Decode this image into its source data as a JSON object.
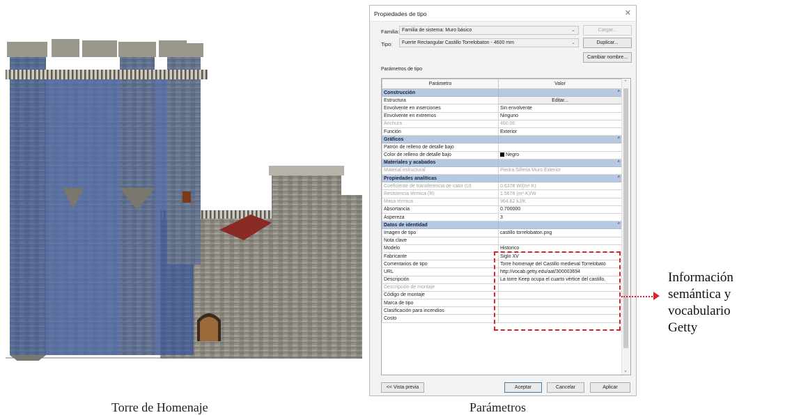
{
  "captions": {
    "left": "Torre de Homenaje",
    "right": "Parámetros"
  },
  "annotation": {
    "lines": [
      "Información",
      "semántica y",
      "vocabulario",
      "Getty"
    ],
    "color": "#e0202a"
  },
  "dialog": {
    "title": "Propiedades de tipo",
    "family_label": "Familia:",
    "family_value": "Familia de sistema: Muro básico",
    "type_label": "Tipo:",
    "type_value": "Fuerte Rectangular Castillo Torrelobaton - 4600 mm",
    "load_button": "Cargar...",
    "duplicate_button": "Duplicar...",
    "rename_button": "Cambiar nombre...",
    "params_label": "Parámetros de tipo",
    "col_param": "Parámetro",
    "col_value": "Valor",
    "preview_button": "<< Vista previa",
    "ok_button": "Aceptar",
    "cancel_button": "Cancelar",
    "apply_button": "Aplicar",
    "rows": [
      {
        "kind": "group",
        "param": "Construcción"
      },
      {
        "kind": "button",
        "param": "Estructura",
        "value": "Editar..."
      },
      {
        "kind": "row",
        "param": "Envolvente en inserciones",
        "value": "Sin envolvente"
      },
      {
        "kind": "row",
        "param": "Envolvente en extremos",
        "value": "Ninguno"
      },
      {
        "kind": "dim",
        "param": "Anchura",
        "value": "460.00"
      },
      {
        "kind": "row",
        "param": "Función",
        "value": "Exterior"
      },
      {
        "kind": "group",
        "param": "Gráficos"
      },
      {
        "kind": "row",
        "param": "Patrón de relleno de detalle bajo",
        "value": ""
      },
      {
        "kind": "swatch",
        "param": "Color de relleno de detalle bajo",
        "value": "Negro"
      },
      {
        "kind": "group",
        "param": "Materiales y acabados"
      },
      {
        "kind": "dim",
        "param": "Material estructural",
        "value": "Piedra Silleria Muro Exterior"
      },
      {
        "kind": "group",
        "param": "Propiedades analíticas"
      },
      {
        "kind": "dim",
        "param": "Coeficiente de transferencia de calor (U)",
        "value": "0.6378 W/(m²·K)"
      },
      {
        "kind": "dim",
        "param": "Resistencia térmica (R)",
        "value": "1.5678 (m²·K)/W"
      },
      {
        "kind": "dim",
        "param": "Masa térmica",
        "value": "964.62 kJ/K"
      },
      {
        "kind": "row",
        "param": "Absortancia",
        "value": "0.700000"
      },
      {
        "kind": "row",
        "param": "Aspereza",
        "value": "3"
      },
      {
        "kind": "group",
        "param": "Datos de identidad"
      },
      {
        "kind": "row",
        "param": "Imagen de tipo",
        "value": "castillo torrelobaton.png"
      },
      {
        "kind": "row",
        "param": "Nota clave",
        "value": ""
      },
      {
        "kind": "row",
        "param": "Modelo",
        "value": "Historico"
      },
      {
        "kind": "row",
        "param": "Fabricante",
        "value": "Siglo XV"
      },
      {
        "kind": "row",
        "param": "Comentarios de tipo",
        "value": "Torre homenaje del Castillo medieval Torrelobató"
      },
      {
        "kind": "row",
        "param": "URL",
        "value": "http://vocab.getty.edu/aat/300003694"
      },
      {
        "kind": "row",
        "param": "Descripción",
        "value": "La torre Keep ocupa el cuarto vértice del castillo."
      },
      {
        "kind": "dim",
        "param": "Descripción de montaje",
        "value": ""
      },
      {
        "kind": "row",
        "param": "Código de montaje",
        "value": ""
      },
      {
        "kind": "row",
        "param": "Marca de tipo",
        "value": ""
      },
      {
        "kind": "row",
        "param": "Clasificación para incendios",
        "value": ""
      },
      {
        "kind": "row",
        "param": "Costo",
        "value": ""
      }
    ]
  }
}
